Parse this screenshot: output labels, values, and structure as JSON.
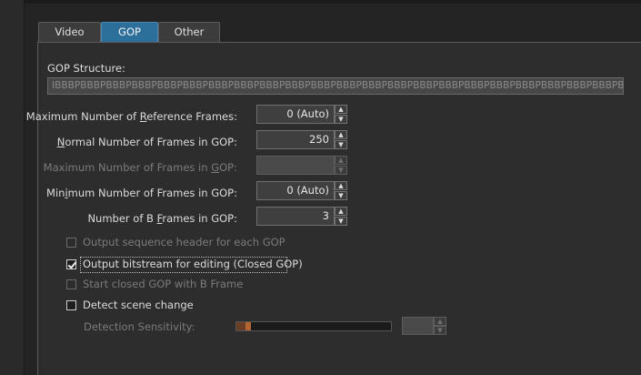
{
  "tabs": [
    {
      "label": "Video"
    },
    {
      "label": "GOP"
    },
    {
      "label": "Other"
    }
  ],
  "gop_structure": {
    "label": "GOP Structure:",
    "value": "IBBBPBBBPBBBPBBBPBBBPBBBPBBBPBBBPBBBPBBBPBBBPBBBPBBBPBBBPBBBPBBBPBBBPBBBPBBBPBBBPBBBPBBBPBBBPBBBPBBBPBBBPBBBPBBBPBBBPBBBPBBBPBBBPBBBPBBBPBBBPB"
  },
  "fields": {
    "max_ref_frames": {
      "label_pre": "Maximum Number of ",
      "label_u": "R",
      "label_post": "eference Frames:",
      "value": "0 (Auto)",
      "enabled": true
    },
    "normal_frames_gop": {
      "label_pre": "",
      "label_u": "N",
      "label_post": "ormal Number of Frames in GOP:",
      "value": "250",
      "enabled": true
    },
    "max_frames_gop": {
      "label_pre": "Maximum Number of Frames in ",
      "label_u": "G",
      "label_post": "OP:",
      "value": "",
      "enabled": false
    },
    "min_frames_gop": {
      "label_pre": "Min",
      "label_u": "i",
      "label_post": "mum Number of Frames in GOP:",
      "value": "0 (Auto)",
      "enabled": true
    },
    "b_frames_gop": {
      "label_pre": "Number of B ",
      "label_u": "F",
      "label_post": "rames in GOP:",
      "value": "3",
      "enabled": true
    }
  },
  "checkboxes": {
    "seq_header": {
      "label": "Output sequence header for each GOP",
      "checked": false,
      "enabled": false
    },
    "closed_gop": {
      "label": "Output bitstream for editing (Closed GOP)",
      "checked": true,
      "enabled": true
    },
    "closed_gop_bframe": {
      "label": "Start closed GOP with B Frame",
      "checked": false,
      "enabled": false
    },
    "scene_change": {
      "label": "Detect scene change",
      "checked": false,
      "enabled": true
    }
  },
  "detection": {
    "label": "Detection Sensitivity:",
    "level": 0.06,
    "value": "",
    "enabled": false
  },
  "icons": {
    "spin_up": "▲",
    "spin_down": "▼"
  },
  "colors": {
    "active_tab": "#2c6f9a",
    "slider_thumb": "#b26533"
  }
}
